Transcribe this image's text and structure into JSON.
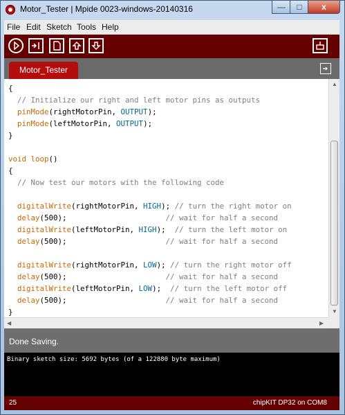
{
  "window": {
    "title": "Motor_Tester | Mpide 0023-windows-20140316",
    "minimize": "—",
    "maximize": "□",
    "close": "x"
  },
  "menu": [
    "File",
    "Edit",
    "Sketch",
    "Tools",
    "Help"
  ],
  "toolbar": {
    "verify_icon": "play-icon",
    "upload_icon": "upload-icon",
    "new_icon": "new-file-icon",
    "open_icon": "open-icon",
    "save_icon": "save-icon",
    "monitor_icon": "serial-monitor-icon"
  },
  "tabs": [
    {
      "label": "Motor_Tester"
    }
  ],
  "code_lines": [
    [
      {
        "text": "{",
        "cls": ""
      }
    ],
    [
      {
        "text": "  // Initialize our right and left motor pins as outputs",
        "cls": "cmt"
      }
    ],
    [
      {
        "text": "  ",
        "cls": ""
      },
      {
        "text": "pinMode",
        "cls": "kw"
      },
      {
        "text": "(rightMotorPin, ",
        "cls": ""
      },
      {
        "text": "OUTPUT",
        "cls": "const"
      },
      {
        "text": ");",
        "cls": ""
      }
    ],
    [
      {
        "text": "  ",
        "cls": ""
      },
      {
        "text": "pinMode",
        "cls": "kw"
      },
      {
        "text": "(leftMotorPin, ",
        "cls": ""
      },
      {
        "text": "OUTPUT",
        "cls": "const"
      },
      {
        "text": ");",
        "cls": ""
      }
    ],
    [
      {
        "text": "}",
        "cls": ""
      }
    ],
    [
      {
        "text": "",
        "cls": ""
      }
    ],
    [
      {
        "text": "void",
        "cls": "kw"
      },
      {
        "text": " ",
        "cls": ""
      },
      {
        "text": "loop",
        "cls": "kw"
      },
      {
        "text": "()",
        "cls": ""
      }
    ],
    [
      {
        "text": "{",
        "cls": ""
      }
    ],
    [
      {
        "text": "  // Now test our motors with the following code",
        "cls": "cmt"
      }
    ],
    [
      {
        "text": "",
        "cls": ""
      }
    ],
    [
      {
        "text": "  ",
        "cls": ""
      },
      {
        "text": "digitalWrite",
        "cls": "kw"
      },
      {
        "text": "(rightMotorPin, ",
        "cls": ""
      },
      {
        "text": "HIGH",
        "cls": "const"
      },
      {
        "text": "); ",
        "cls": ""
      },
      {
        "text": "// turn the right motor on",
        "cls": "cmt"
      }
    ],
    [
      {
        "text": "  ",
        "cls": ""
      },
      {
        "text": "delay",
        "cls": "kw"
      },
      {
        "text": "(500);                      ",
        "cls": ""
      },
      {
        "text": "// wait for half a second",
        "cls": "cmt"
      }
    ],
    [
      {
        "text": "  ",
        "cls": ""
      },
      {
        "text": "digitalWrite",
        "cls": "kw"
      },
      {
        "text": "(leftMotorPin, ",
        "cls": ""
      },
      {
        "text": "HIGH",
        "cls": "const"
      },
      {
        "text": ");  ",
        "cls": ""
      },
      {
        "text": "// turn the left motor on",
        "cls": "cmt"
      }
    ],
    [
      {
        "text": "  ",
        "cls": ""
      },
      {
        "text": "delay",
        "cls": "kw"
      },
      {
        "text": "(500);                      ",
        "cls": ""
      },
      {
        "text": "// wait for half a second",
        "cls": "cmt"
      }
    ],
    [
      {
        "text": "",
        "cls": ""
      }
    ],
    [
      {
        "text": "  ",
        "cls": ""
      },
      {
        "text": "digitalWrite",
        "cls": "kw"
      },
      {
        "text": "(rightMotorPin, ",
        "cls": ""
      },
      {
        "text": "LOW",
        "cls": "const"
      },
      {
        "text": "); ",
        "cls": ""
      },
      {
        "text": "// turn the right motor off",
        "cls": "cmt"
      }
    ],
    [
      {
        "text": "  ",
        "cls": ""
      },
      {
        "text": "delay",
        "cls": "kw"
      },
      {
        "text": "(500);                      ",
        "cls": ""
      },
      {
        "text": "// wait for half a second",
        "cls": "cmt"
      }
    ],
    [
      {
        "text": "  ",
        "cls": ""
      },
      {
        "text": "digitalWrite",
        "cls": "kw"
      },
      {
        "text": "(leftMotorPin, ",
        "cls": ""
      },
      {
        "text": "LOW",
        "cls": "const"
      },
      {
        "text": ");  ",
        "cls": ""
      },
      {
        "text": "// turn the left motor off",
        "cls": "cmt"
      }
    ],
    [
      {
        "text": "  ",
        "cls": ""
      },
      {
        "text": "delay",
        "cls": "kw"
      },
      {
        "text": "(500);                      ",
        "cls": ""
      },
      {
        "text": "// wait for half a second",
        "cls": "cmt"
      }
    ],
    [
      {
        "text": "}",
        "cls": ""
      }
    ]
  ],
  "status": {
    "message": "Done Saving."
  },
  "console": {
    "text": "Binary sketch size: 5692 bytes (of a 122880 byte maximum)"
  },
  "footer": {
    "line": "25",
    "board": "chipKIT DP32 on COM8"
  },
  "colors": {
    "toolbar": "#640000",
    "tab": "#b50c0c",
    "keyword": "#cc6600",
    "constant": "#006699",
    "comment": "#7e7e7e"
  }
}
